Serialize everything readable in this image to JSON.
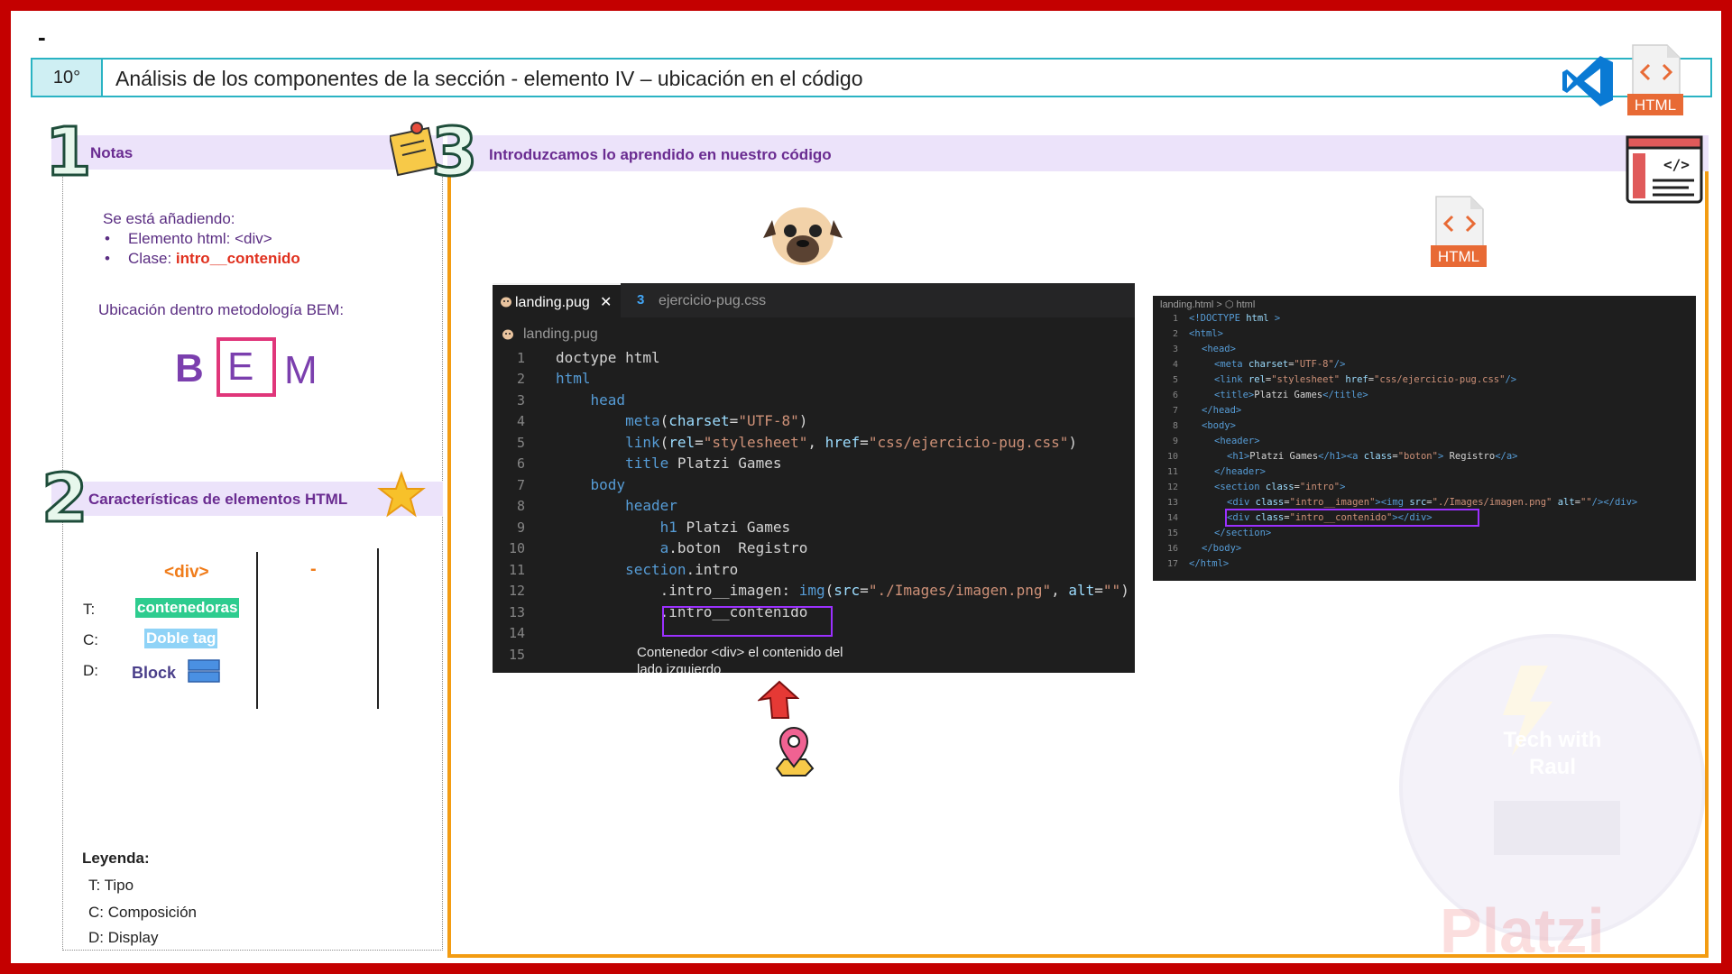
{
  "header": {
    "dash": "-",
    "number": "10°",
    "title": "Análisis de los componentes de la sección   - elemento IV – ubicación en el código",
    "html_badge": "HTML"
  },
  "notes": {
    "number": "1",
    "title": "Notas",
    "intro": "Se está añadiendo:",
    "item1": "Elemento html: <div>",
    "item2_label": "Clase: ",
    "item2_value": "intro__contenido",
    "bem_label": "Ubicación dentro metodología BEM:",
    "bem_b": "B",
    "bem_e": "E",
    "bem_m": "M"
  },
  "characteristics": {
    "number": "2",
    "title": "Características de elementos HTML",
    "element": "<div>",
    "empty_col": "-",
    "t_label": "T:",
    "c_label": "C:",
    "d_label": "D:",
    "t_value": "contenedoras",
    "c_value": "Doble tag",
    "d_value": "Block",
    "legend_title": "Leyenda:",
    "legend": [
      "T:  Tipo",
      "C:  Composición",
      "D:  Display"
    ]
  },
  "main": {
    "number": "3",
    "title": "Introduzcamos lo aprendido en nuestro código",
    "html_badge": "HTML",
    "editor": {
      "tab_active": "landing.pug",
      "tab_close": "✕",
      "tab_other": "ejercicio-pug.css",
      "breadcrumb": "landing.pug",
      "note_line1": "Contenedor <div> el contenido del",
      "note_line2": "lado izquierdo"
    },
    "editor2": {
      "breadcrumb": "landing.html > ⬡ html"
    }
  },
  "watermark": {
    "brand": "Platzi",
    "line1": "Tech with",
    "line2": "Raul"
  },
  "colors": {
    "frame": "#c40000",
    "accent_orange": "#f39c12",
    "title_teal": "#2ab3c3",
    "panel_head": "#ece3fa",
    "highlight_purple": "#9b30ff"
  }
}
